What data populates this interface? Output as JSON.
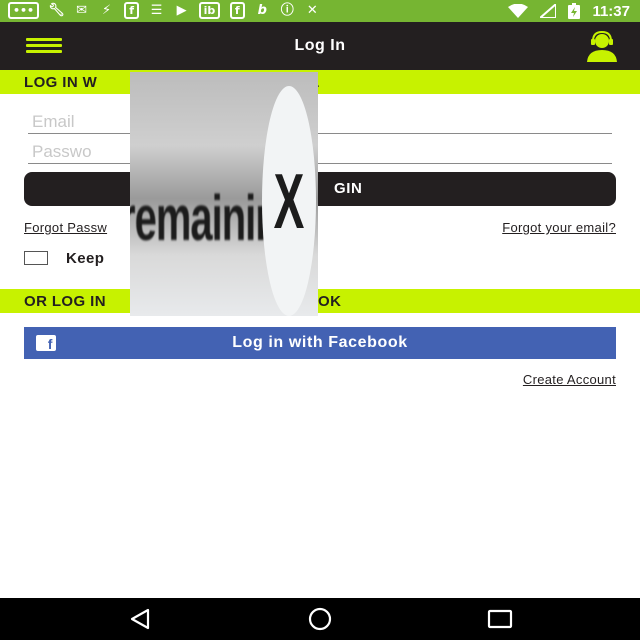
{
  "status_bar": {
    "time": "11:37",
    "icons": [
      "chat-icon",
      "wrench-icon",
      "messenger-icon",
      "zedge-icon",
      "facebook-icon",
      "stack-icon",
      "facetime-icon",
      "ib-icon",
      "facebook-icon",
      "b-icon",
      "info-icon",
      "no-signal-icon",
      "wifi-icon",
      "cellular-icon",
      "battery-charging-icon"
    ]
  },
  "header": {
    "title": "Log In"
  },
  "login_section": {
    "banner_text": "LOG IN W",
    "banner_text_tail": "L",
    "email_placeholder": "Email",
    "password_placeholder": "Passwo",
    "login_button_label": "GIN",
    "forgot_password": "Forgot Passw",
    "forgot_email": "Forgot your email?",
    "keep_label": "Keep"
  },
  "facebook_section": {
    "banner_text": "OR LOG IN",
    "banner_text_tail": "OK",
    "button_label": "Log in with Facebook"
  },
  "create_account": "Create Account",
  "ad_overlay": {
    "text": "remaining",
    "close_glyph": "X"
  },
  "colors": {
    "status_bar": "#76b532",
    "app_bar": "#231f20",
    "accent": "#c7f200",
    "facebook": "#4362b3"
  }
}
